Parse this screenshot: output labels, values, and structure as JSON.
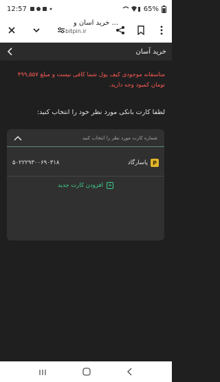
{
  "status": {
    "time": "12:57",
    "battery": "65%"
  },
  "browser": {
    "page_title": "خرید آسان و ...",
    "domain": "bitpin.ir"
  },
  "app": {
    "header_title": "خرید آسان"
  },
  "message": {
    "warning": "متاسفانه موجودی کیف پول شما کافی نیست و مبلغ ۴۹۹,۵۵۷ تومان کمبود وجه دارید.",
    "prompt": "لطفا کارت بانکی مورد نظر خود را انتخاب کنید:"
  },
  "card_list": {
    "header_label": "شماره کارت مورد نظر را انتخاب کنید",
    "cards": [
      {
        "bank_name": "پاسارگاد",
        "account_number": "۵۰۲۲۲۹۳۰۰۶۹۰۳۱۸"
      }
    ],
    "add_card_label": "افزودن کارت جدید"
  },
  "colors": {
    "warning": "#ff5a55",
    "accent": "#3ecf8e",
    "background": "#1f1f1f",
    "card": "#303030"
  },
  "icons": [
    "notification-icons",
    "wifi-icon",
    "battery-icon",
    "close-icon",
    "chevron-down-icon",
    "site-settings-icon",
    "share-icon",
    "bookmark-icon",
    "more-icon",
    "chevron-left-icon",
    "chevron-up-icon",
    "bank-logo-icon",
    "plus-icon",
    "recents-icon",
    "home-icon",
    "back-icon"
  ]
}
